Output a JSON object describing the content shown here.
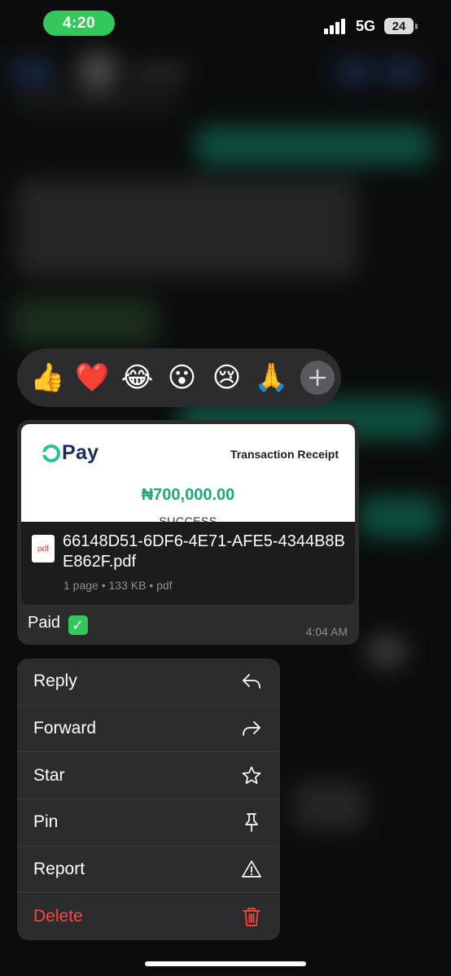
{
  "status_bar": {
    "time": "4:20",
    "network": "5G",
    "battery": "24"
  },
  "reactions": {
    "items": [
      {
        "emoji": "👍",
        "name": "thumbs-up"
      },
      {
        "emoji": "❤️",
        "name": "red-heart"
      },
      {
        "emoji": "😂",
        "name": "tears-of-joy"
      },
      {
        "emoji": "😮",
        "name": "open-mouth"
      },
      {
        "emoji": "😢",
        "name": "crying-face"
      },
      {
        "emoji": "🙏",
        "name": "folded-hands"
      }
    ],
    "more_icon": "plus-icon"
  },
  "message": {
    "preview": {
      "brand": "Pay",
      "receipt_title": "Transaction Receipt",
      "amount": "₦700,000.00",
      "status": "SUCCESS"
    },
    "file": {
      "icon_label": "pdf",
      "name": "66148D51-6DF6-4E71-AFE5-4344B8BE862F.pdf",
      "meta": "1 page • 133 KB • pdf"
    },
    "caption": "Paid",
    "caption_check": "✓",
    "time": "4:04 AM"
  },
  "menu": {
    "items": [
      {
        "label": "Reply",
        "icon": "reply-icon"
      },
      {
        "label": "Forward",
        "icon": "forward-icon"
      },
      {
        "label": "Star",
        "icon": "star-icon"
      },
      {
        "label": "Pin",
        "icon": "pin-icon"
      },
      {
        "label": "Report",
        "icon": "warning-icon"
      },
      {
        "label": "Delete",
        "icon": "trash-icon"
      }
    ]
  },
  "colors": {
    "accent_green": "#34c759",
    "danger": "#ff453a",
    "opay_green": "#1fc59a",
    "amount_green": "#1fa97a",
    "menu_bg": "#2c2c2e"
  }
}
